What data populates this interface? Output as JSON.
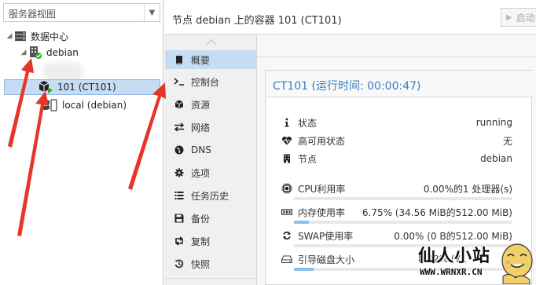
{
  "server_view": {
    "label": "服务器视图"
  },
  "tree": {
    "datacenter": "数据中心",
    "node": "debian",
    "container": "101 (CT101)",
    "storage": "local (debian)"
  },
  "header": {
    "title": "节点 debian 上的容器 101 (CT101)",
    "start_label": "启动"
  },
  "nav": {
    "items": [
      {
        "label": "概要",
        "icon": "book-icon"
      },
      {
        "label": "控制台",
        "icon": "terminal-icon"
      },
      {
        "label": "资源",
        "icon": "cube-icon"
      },
      {
        "label": "网络",
        "icon": "exchange-icon"
      },
      {
        "label": "DNS",
        "icon": "globe-icon"
      },
      {
        "label": "选项",
        "icon": "gear-icon"
      },
      {
        "label": "任务历史",
        "icon": "list-icon"
      },
      {
        "label": "备份",
        "icon": "floppy-icon"
      },
      {
        "label": "复制",
        "icon": "retweet-icon"
      },
      {
        "label": "快照",
        "icon": "history-icon"
      }
    ]
  },
  "summary": {
    "title": "CT101 (运行时间: 00:00:47)",
    "rows": [
      {
        "label": "状态",
        "value": "running",
        "icon": "info-icon"
      },
      {
        "label": "高可用状态",
        "value": "无",
        "icon": "heartbeat-icon"
      },
      {
        "label": "节点",
        "value": "debian",
        "icon": "building-icon"
      }
    ],
    "metrics": [
      {
        "label": "CPU利用率",
        "value": "0.00%的1 处理器(s)",
        "icon": "cpu-icon",
        "percent": 0.0
      },
      {
        "label": "内存使用率",
        "value": "6.75% (34.56 MiB的512.00 MiB)",
        "icon": "memory-icon",
        "percent": 6.75
      },
      {
        "label": "SWAP使用率",
        "value": "0.00% (0 B的512.00 MiB)",
        "icon": "refresh-icon",
        "percent": 0.0
      },
      {
        "label": "引导磁盘大小",
        "value": "8.92% (71",
        "icon": "hdd-icon",
        "percent": 8.92
      }
    ]
  },
  "watermark": {
    "title": "仙人小站",
    "url": "WWW.WRNXR.CN"
  }
}
